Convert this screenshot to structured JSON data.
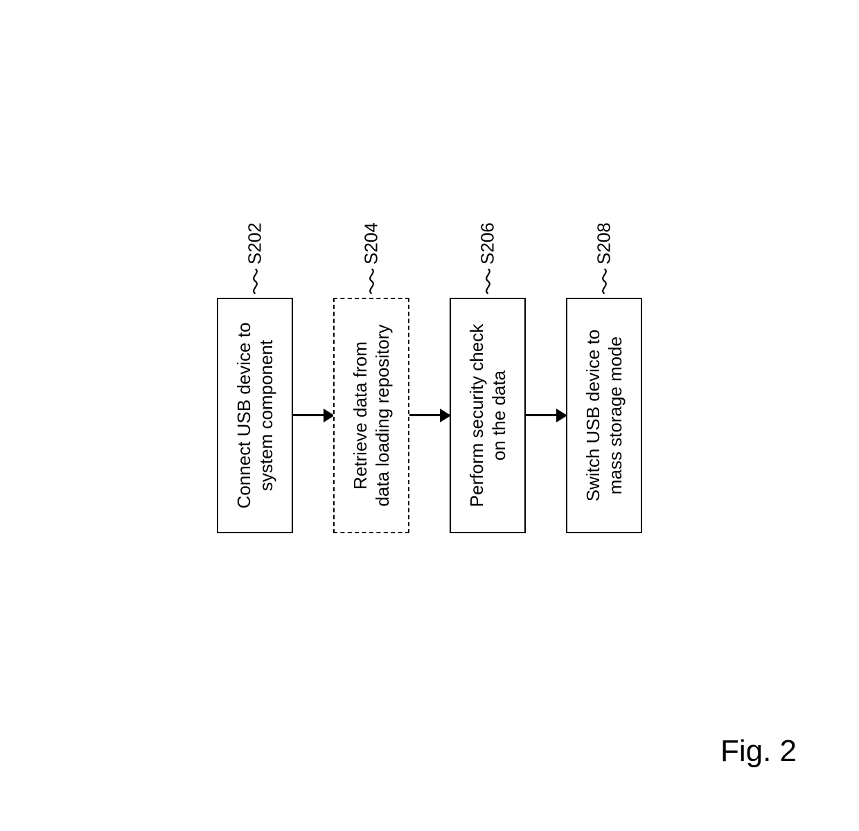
{
  "chart_data": {
    "type": "flowchart",
    "orientation": "vertical (rendered rotated -90deg, so flows left-to-right visually but text reads bottom-to-top)",
    "steps": [
      {
        "id": "S202",
        "text": "Connect USB device to system component",
        "style": "solid"
      },
      {
        "id": "S204",
        "text": "Retrieve data from data loading repository",
        "style": "dashed"
      },
      {
        "id": "S206",
        "text": "Perform security check on the data",
        "style": "solid"
      },
      {
        "id": "S208",
        "text": "Switch USB device to mass storage mode",
        "style": "solid"
      }
    ],
    "connections": [
      {
        "from": "S202",
        "to": "S204"
      },
      {
        "from": "S204",
        "to": "S206"
      },
      {
        "from": "S206",
        "to": "S208"
      }
    ]
  },
  "steps": {
    "s0": {
      "label": "S202",
      "line1": "Connect USB device to",
      "line2": "system component"
    },
    "s1": {
      "label": "S204",
      "line1": "Retrieve data from",
      "line2": "data loading repository"
    },
    "s2": {
      "label": "S206",
      "line1": "Perform security check",
      "line2": "on the data"
    },
    "s3": {
      "label": "S208",
      "line1": "Switch USB device to",
      "line2": "mass storage mode"
    }
  },
  "figure_label": "Fig. 2"
}
